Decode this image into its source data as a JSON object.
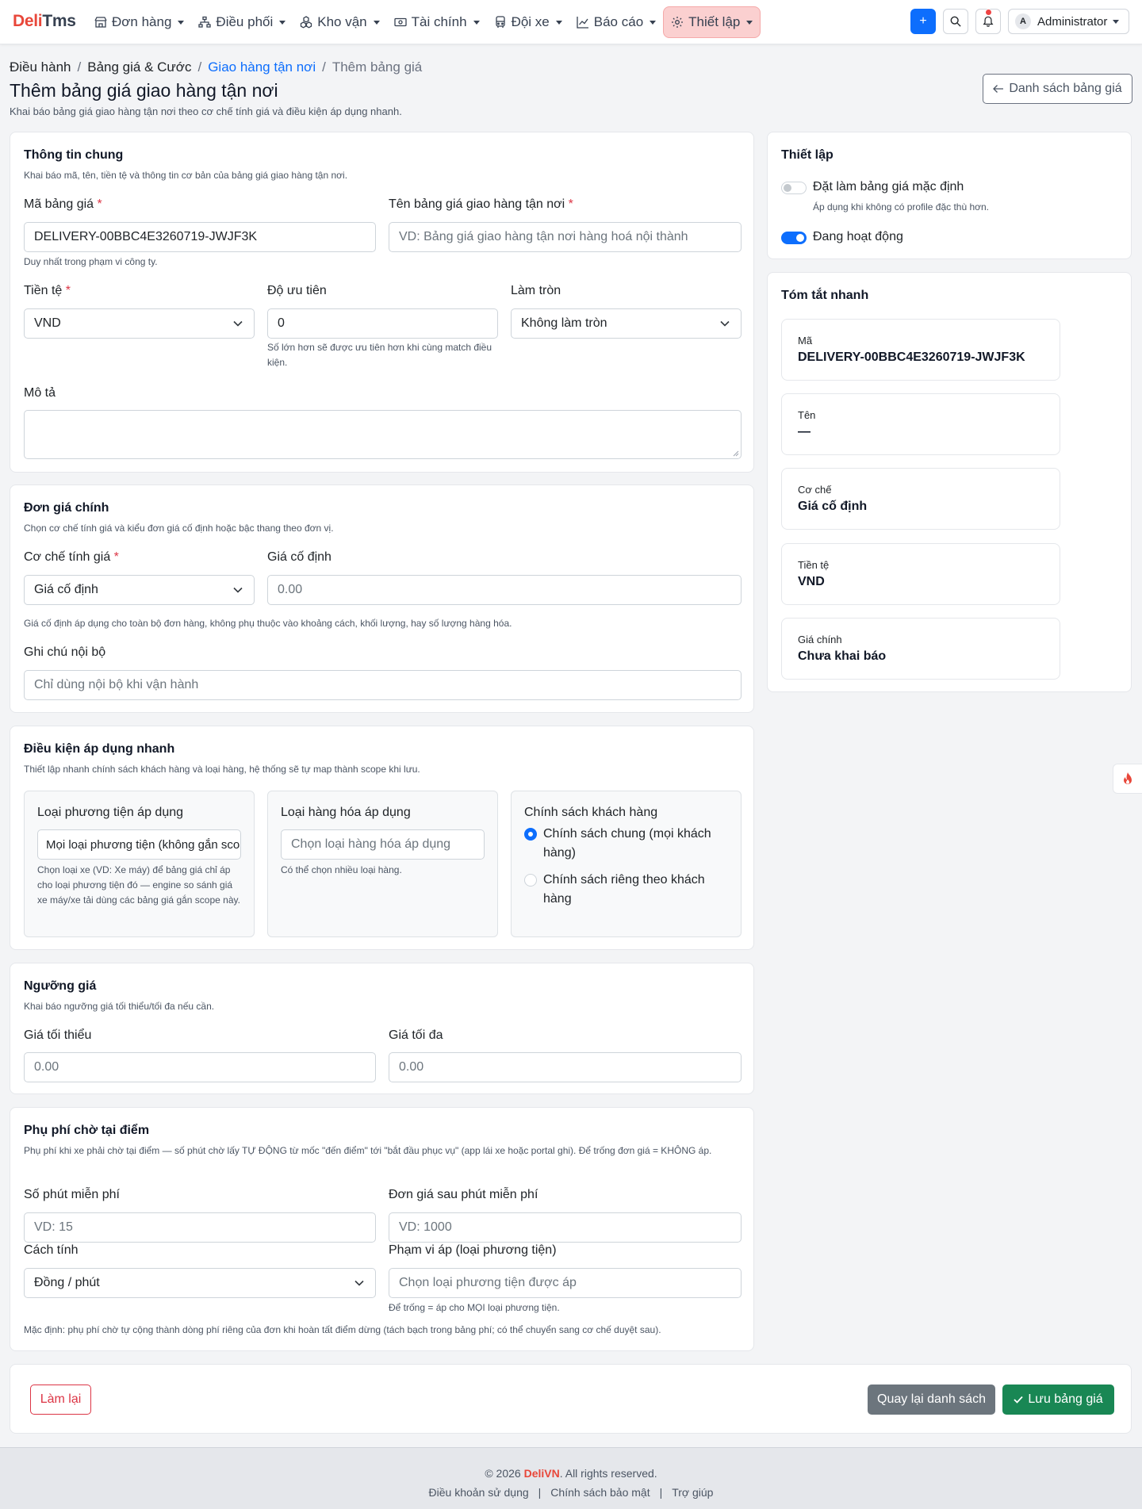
{
  "brand": {
    "part1": "Deli",
    "part2": "Tms"
  },
  "nav": [
    {
      "label": "Đơn hàng"
    },
    {
      "label": "Điều phối"
    },
    {
      "label": "Kho vận"
    },
    {
      "label": "Tài chính"
    },
    {
      "label": "Đội xe"
    },
    {
      "label": "Báo cáo"
    },
    {
      "label": "Thiết lập",
      "active": true
    }
  ],
  "toolbar": {
    "add_label": "+",
    "user_initial": "A",
    "user_name": "Administrator"
  },
  "breadcrumb": {
    "c1": "Điều hành",
    "c2": "Bảng giá & Cước",
    "c3": "Giao hàng tận nơi",
    "c4": "Thêm bảng giá"
  },
  "page": {
    "title": "Thêm bảng giá giao hàng tận nơi",
    "subtitle": "Khai báo bảng giá giao hàng tận nơi theo cơ chế tính giá và điều kiện áp dụng nhanh.",
    "back_button": "Danh sách bảng giá"
  },
  "general": {
    "title": "Thông tin chung",
    "hint": "Khai báo mã, tên, tiền tệ và thông tin cơ bản của bảng giá giao hàng tận nơi.",
    "code_label": "Mã bảng giá",
    "code_value": "DELIVERY-00BBC4E3260719-JWJF3K",
    "code_help": "Duy nhất trong phạm vi công ty.",
    "name_label": "Tên bảng giá giao hàng tận nơi",
    "name_placeholder": "VD: Bảng giá giao hàng tận nơi hàng hoá nội thành",
    "currency_label": "Tiền tệ",
    "currency_value": "VND",
    "priority_label": "Độ ưu tiên",
    "priority_value": "0",
    "priority_help": "Số lớn hơn sẽ được ưu tiên hơn khi cùng match điều kiện.",
    "rounding_label": "Làm tròn",
    "rounding_value": "Không làm tròn",
    "desc_label": "Mô tả"
  },
  "main_price": {
    "title": "Đơn giá chính",
    "hint": "Chọn cơ chế tính giá và kiểu đơn giá cố định hoặc bậc thang theo đơn vị.",
    "mechanism_label": "Cơ chế tính giá",
    "mechanism_value": "Giá cố định",
    "fixed_label": "Giá cố định",
    "fixed_placeholder": "0.00",
    "fixed_help": "Giá cố định áp dụng cho toàn bộ đơn hàng, không phụ thuộc vào khoảng cách, khối lượng, hay số lượng hàng hóa.",
    "note_label": "Ghi chú nội bộ",
    "note_placeholder": "Chỉ dùng nội bộ khi vận hành"
  },
  "conditions": {
    "title": "Điều kiện áp dụng nhanh",
    "hint": "Thiết lập nhanh chính sách khách hàng và loại hàng, hệ thống sẽ tự map thành scope khi lưu.",
    "vehicle_label": "Loại phương tiện áp dụng",
    "vehicle_value": "Mọi loại phương tiện (không gắn scope)",
    "vehicle_help": "Chọn loại xe (VD: Xe máy) để bảng giá chỉ áp cho loại phương tiện đó — engine so sánh giá xe máy/xe tải dùng các bảng giá gắn scope này.",
    "goods_label": "Loại hàng hóa áp dụng",
    "goods_placeholder": "Chọn loại hàng hóa áp dụng",
    "goods_help": "Có thể chọn nhiều loại hàng.",
    "policy_label": "Chính sách khách hàng",
    "policy_general": "Chính sách chung (mọi khách hàng)",
    "policy_specific": "Chính sách riêng theo khách hàng"
  },
  "threshold": {
    "title": "Ngưỡng giá",
    "hint": "Khai báo ngưỡng giá tối thiểu/tối đa nếu cần.",
    "min_label": "Giá tối thiểu",
    "min_placeholder": "0.00",
    "max_label": "Giá tối đa",
    "max_placeholder": "0.00"
  },
  "waiting": {
    "title": "Phụ phí chờ tại điểm",
    "hint": "Phụ phí khi xe phải chờ tại điểm — số phút chờ lấy TỰ ĐỘNG từ mốc \"đến điểm\" tới \"bắt đầu phục vụ\" (app lái xe hoặc portal ghi). Để trống đơn giá = KHÔNG áp.",
    "free_label": "Số phút miễn phí",
    "free_placeholder": "VD: 15",
    "rate_label": "Đơn giá sau phút miễn phí",
    "rate_placeholder": "VD: 1000",
    "method_label": "Cách tính",
    "method_value": "Đồng / phút",
    "scope_label": "Phạm vi áp (loại phương tiện)",
    "scope_placeholder": "Chọn loại phương tiện được áp",
    "scope_help": "Để trống = áp cho MỌI loại phương tiện.",
    "default_note": "Mặc định: phụ phí chờ tự cộng thành dòng phí riêng của đơn khi hoàn tất điểm dừng (tách bạch trong bảng phí; có thể chuyển sang cơ chế duyệt sau)."
  },
  "settings": {
    "title": "Thiết lập",
    "default_label": "Đặt làm bảng giá mặc định",
    "default_help": "Áp dụng khi không có profile đặc thù hơn.",
    "default_on": false,
    "active_label": "Đang hoạt động",
    "active_on": true
  },
  "summary": {
    "title": "Tóm tắt nhanh",
    "items": [
      {
        "key": "Mã",
        "value": "DELIVERY-00BBC4E3260719-JWJF3K"
      },
      {
        "key": "Tên",
        "value": "—"
      },
      {
        "key": "Cơ chế",
        "value": "Giá cố định"
      },
      {
        "key": "Tiền tệ",
        "value": "VND"
      },
      {
        "key": "Giá chính",
        "value": "Chưa khai báo"
      }
    ]
  },
  "actions": {
    "reset": "Làm lại",
    "back": "Quay lại danh sách",
    "save": "Lưu bảng giá"
  },
  "footer": {
    "copy_prefix": "© 2026 ",
    "brand": "DeliVN",
    "copy_suffix": ". All rights reserved.",
    "links": [
      "Điều khoản sử dụng",
      "Chính sách bảo mật",
      "Trợ giúp"
    ]
  },
  "colors": {
    "primary": "#0d6efd",
    "success": "#198754",
    "secondary": "#6c757d",
    "danger": "#dc3545",
    "brand": "#e8473a"
  }
}
